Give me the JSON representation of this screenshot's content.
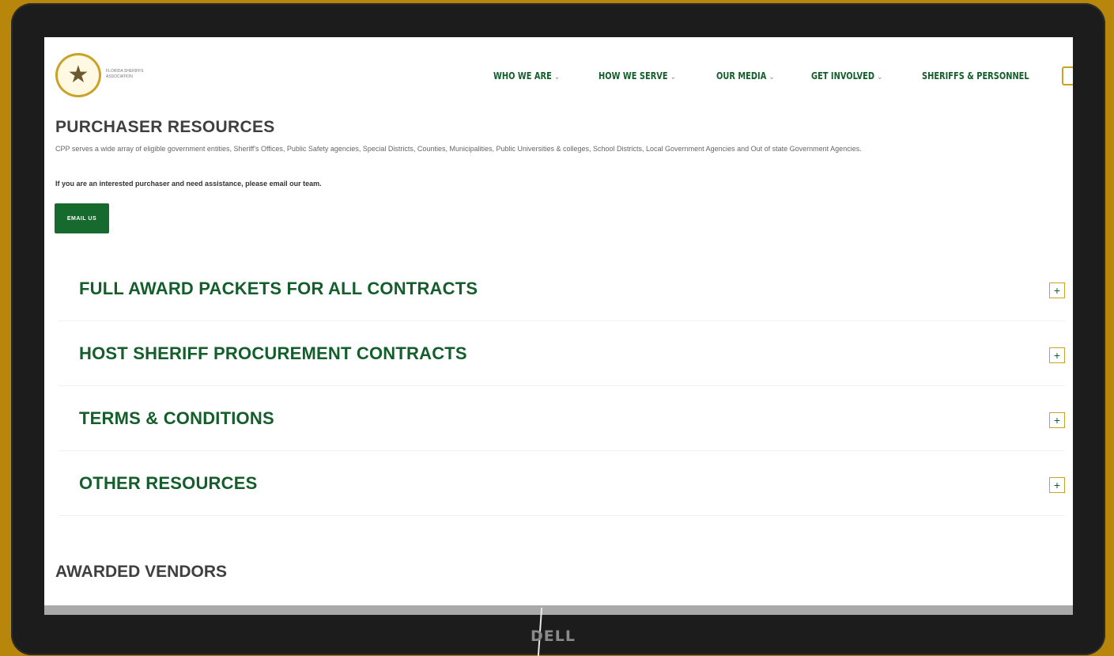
{
  "brand": {
    "logo_text": "FLORIDA SHERIFFS ASSOCIATION",
    "monitor_brand": "DELL"
  },
  "nav": {
    "items": [
      {
        "label": "WHO WE ARE",
        "has_dropdown": true
      },
      {
        "label": "HOW WE SERVE",
        "has_dropdown": true
      },
      {
        "label": "OUR MEDIA",
        "has_dropdown": true
      },
      {
        "label": "GET INVOLVED",
        "has_dropdown": true
      },
      {
        "label": "SHERIFFS & PERSONNEL",
        "has_dropdown": false
      }
    ]
  },
  "main": {
    "title": "PURCHASER RESOURCES",
    "intro": "CPP serves a wide array of eligible government entities, Sheriff's Offices, Public Safety agencies, Special Districts, Counties, Municipalities, Public Universities & colleges, School Districts, Local Government Agencies and Out of state Government Agencies.",
    "interest": "If you are an interested purchaser and need assistance, please email our team.",
    "email_button": "EMAIL US",
    "accordion": [
      {
        "title": "FULL AWARD PACKETS FOR ALL CONTRACTS",
        "toggle": "+"
      },
      {
        "title": "HOST SHERIFF PROCUREMENT CONTRACTS",
        "toggle": "+"
      },
      {
        "title": "TERMS & CONDITIONS",
        "toggle": "+"
      },
      {
        "title": "OTHER RESOURCES",
        "toggle": "+"
      }
    ],
    "vendors_title": "AWARDED VENDORS"
  },
  "colors": {
    "brand_green": "#145e2c",
    "button_green": "#176a2e",
    "gold": "#c9a227",
    "backdrop": "#b8860b"
  },
  "icons": {
    "nav_dropdown": "chevron-down-icon",
    "accordion_toggle": "plus-icon",
    "logo": "sheriff-star-icon"
  }
}
